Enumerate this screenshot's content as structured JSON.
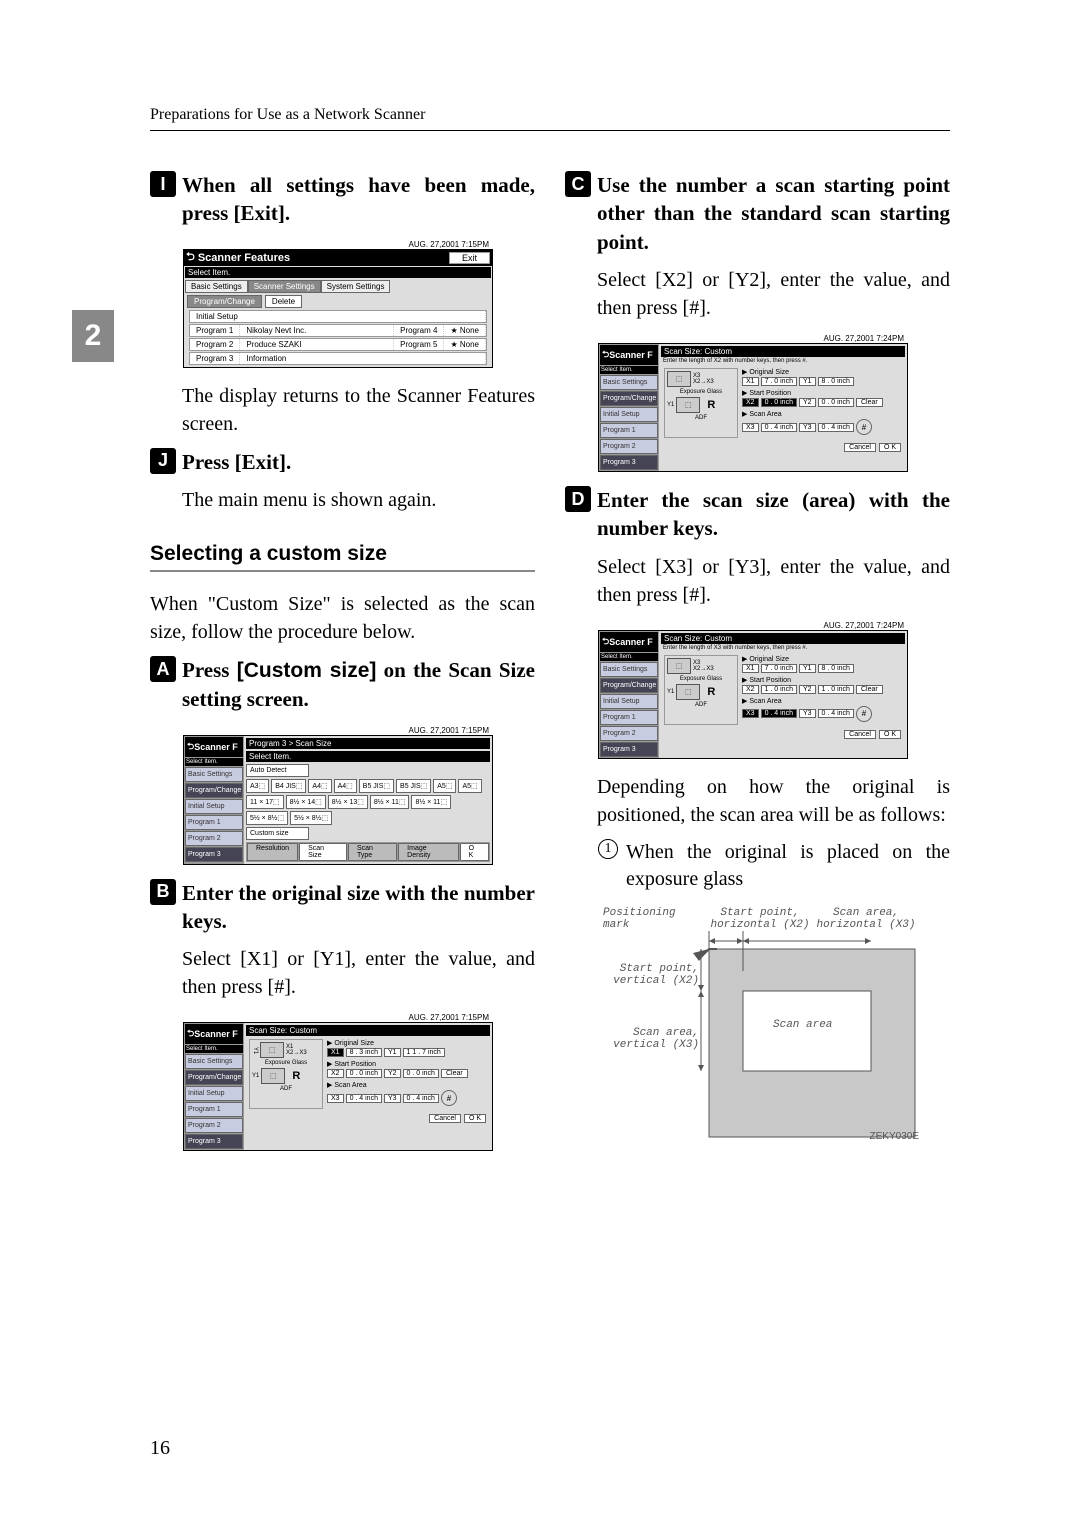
{
  "header": "Preparations for Use as a Network Scanner",
  "side_tab": "2",
  "page_number": "16",
  "left": {
    "step9": {
      "num": "I",
      "text": "When all settings have been made, press [Exit]."
    },
    "ss1": {
      "date": "AUG. 27,2001  7:15PM",
      "title": "Scanner Features",
      "exit": "Exit",
      "select": "Select Item.",
      "tabs": [
        "Basic Settings",
        "Scanner Settings",
        "System Settings"
      ],
      "btns": [
        "Program/Change",
        "Delete"
      ],
      "initial": "Initial Setup",
      "rows": [
        [
          "Program 1",
          "Nikolay Nevt Inc.",
          "Program 4",
          "★ None"
        ],
        [
          "Program 2",
          "Produce SZAKI",
          "Program 5",
          "★ None"
        ],
        [
          "Program 3",
          "Information"
        ]
      ]
    },
    "after9": "The display returns to the Scanner Features screen.",
    "step10": {
      "num": "J",
      "text": "Press [Exit]."
    },
    "after10": "The main menu is shown again.",
    "section": "Selecting a custom size",
    "intro": "When \"Custom Size\" is selected as the scan size, follow the procedure below.",
    "stepA": {
      "num": "A",
      "text_a": "Press ",
      "text_b": "[Custom size]",
      "text_c": " on the Scan Size setting screen."
    },
    "ss2": {
      "date": "AUG. 27,2001  7:15PM",
      "title": "Scanner F",
      "breadcrumb": "Program 3 > Scan Size",
      "select": "Select Item.",
      "side": [
        "Basic Settings",
        "Program/Change",
        "Initial Setup",
        "Program 1",
        "Program 2",
        "Program 3"
      ],
      "auto": "Auto Detect",
      "sizes": [
        "A3⬚",
        "B4 JIS⬚",
        "A4⬚",
        "A4⬚",
        "B5 JIS⬚",
        "B5 JIS⬚",
        "A5⬚",
        "A5⬚",
        "11 × 17⬚",
        "8½ × 14⬚",
        "8½ × 13⬚",
        "8½ × 11⬚",
        "8½ × 11⬚",
        "5½ × 8½⬚",
        "5½ × 8½⬚"
      ],
      "custom": "Custom size",
      "bottom": [
        "Resolution",
        "Scan Size",
        "Scan Type",
        "Image Density"
      ],
      "ok": "O K"
    },
    "stepB": {
      "num": "B",
      "text": "Enter the original size with the number keys."
    },
    "afterB": "Select [X1] or [Y1], enter the value, and then press [#].",
    "ss3": {
      "date": "AUG. 27,2001  7:15PM",
      "title": "Scanner F",
      "breadcrumb": "Scan Size: Custom",
      "side": [
        "Basic Settings",
        "Program/Change",
        "Initial Setup",
        "Program 1",
        "Program 2",
        "Program 3"
      ],
      "diag_labels": [
        "Exposure Glass",
        "ADF"
      ],
      "orig": "▶ Original Size",
      "orig_x": "X1",
      "orig_xv": "8 . 3 inch",
      "orig_y": "Y1",
      "orig_yv": "1 1 . 7 inch",
      "start": "▶ Start Position",
      "start_x": "X2",
      "start_xv": "0 . 0 inch",
      "start_y": "Y2",
      "start_yv": "0 . 0 inch",
      "area": "▶ Scan Area",
      "area_x": "X3",
      "area_xv": "0 . 4 inch",
      "area_y": "Y3",
      "area_yv": "0 . 4 inch",
      "clear": "Clear",
      "hash": "#",
      "cancel": "Cancel",
      "ok": "O K"
    }
  },
  "right": {
    "stepC": {
      "num": "C",
      "text": "Use the number a scan starting point other than the standard scan starting point."
    },
    "afterC": "Select [X2] or [Y2], enter the value, and then press [#].",
    "ss4": {
      "date": "AUG. 27,2001  7:24PM",
      "title": "Scanner F",
      "breadcrumb": "Scan Size: Custom",
      "instr": "Enter the length of X2 with number keys, then press #.",
      "side": [
        "Basic Settings",
        "Program/Change",
        "Initial Setup",
        "Program 1",
        "Program 2",
        "Program 3"
      ],
      "diag_labels": [
        "Exposure Glass",
        "ADF"
      ],
      "orig": "▶ Original Size",
      "orig_x": "X1",
      "orig_xv": "7 . 0 inch",
      "orig_y": "Y1",
      "orig_yv": "8 . 0 inch",
      "start": "▶ Start Position",
      "start_x": "X2",
      "start_xv": "0 . 0 inch",
      "start_y": "Y2",
      "start_yv": "0 . 0 inch",
      "area": "▶ Scan Area",
      "area_x": "X3",
      "area_xv": "0 . 4 inch",
      "area_y": "Y3",
      "area_yv": "0 . 4 inch",
      "clear": "Clear",
      "hash": "#",
      "cancel": "Cancel",
      "ok": "O K"
    },
    "stepD": {
      "num": "D",
      "text": "Enter the scan size (area) with the number keys."
    },
    "afterD": "Select [X3] or [Y3], enter the value, and then press [#].",
    "ss5": {
      "date": "AUG. 27,2001  7:24PM",
      "title": "Scanner F",
      "breadcrumb": "Scan Size: Custom",
      "instr": "Enter the length of X3 with number keys, then press #.",
      "side": [
        "Basic Settings",
        "Program/Change",
        "Initial Setup",
        "Program 1",
        "Program 2",
        "Program 3"
      ],
      "diag_labels": [
        "Exposure Glass",
        "ADF"
      ],
      "orig": "▶ Original Size",
      "orig_x": "X1",
      "orig_xv": "7 . 0 inch",
      "orig_y": "Y1",
      "orig_yv": "8 . 0 inch",
      "start": "▶ Start Position",
      "start_x": "X2",
      "start_xv": "1 . 0 inch",
      "start_y": "Y2",
      "start_yv": "1 . 0 inch",
      "area": "▶ Scan Area",
      "area_x": "X3",
      "area_xv": "0 . 4 inch",
      "area_y": "Y3",
      "area_yv": "0 . 4 inch",
      "clear": "Clear",
      "hash": "#",
      "cancel": "Cancel",
      "ok": "O K"
    },
    "para": "Depending on how the original is positioned, the scan area will be as follows:",
    "legend1_num": "①",
    "legend1": "When the original is placed on the exposure glass",
    "exposure": {
      "pos_mark": "Positioning mark",
      "start_h": "Start point,\nhorizontal (X2)",
      "area_h": "Scan area,\nhorizontal (X3)",
      "start_v": "Start point,\nvertical (X2)",
      "area_v": "Scan area,\nvertical (X3)",
      "scan_area": "Scan area",
      "code": "ZEKY030E"
    }
  }
}
